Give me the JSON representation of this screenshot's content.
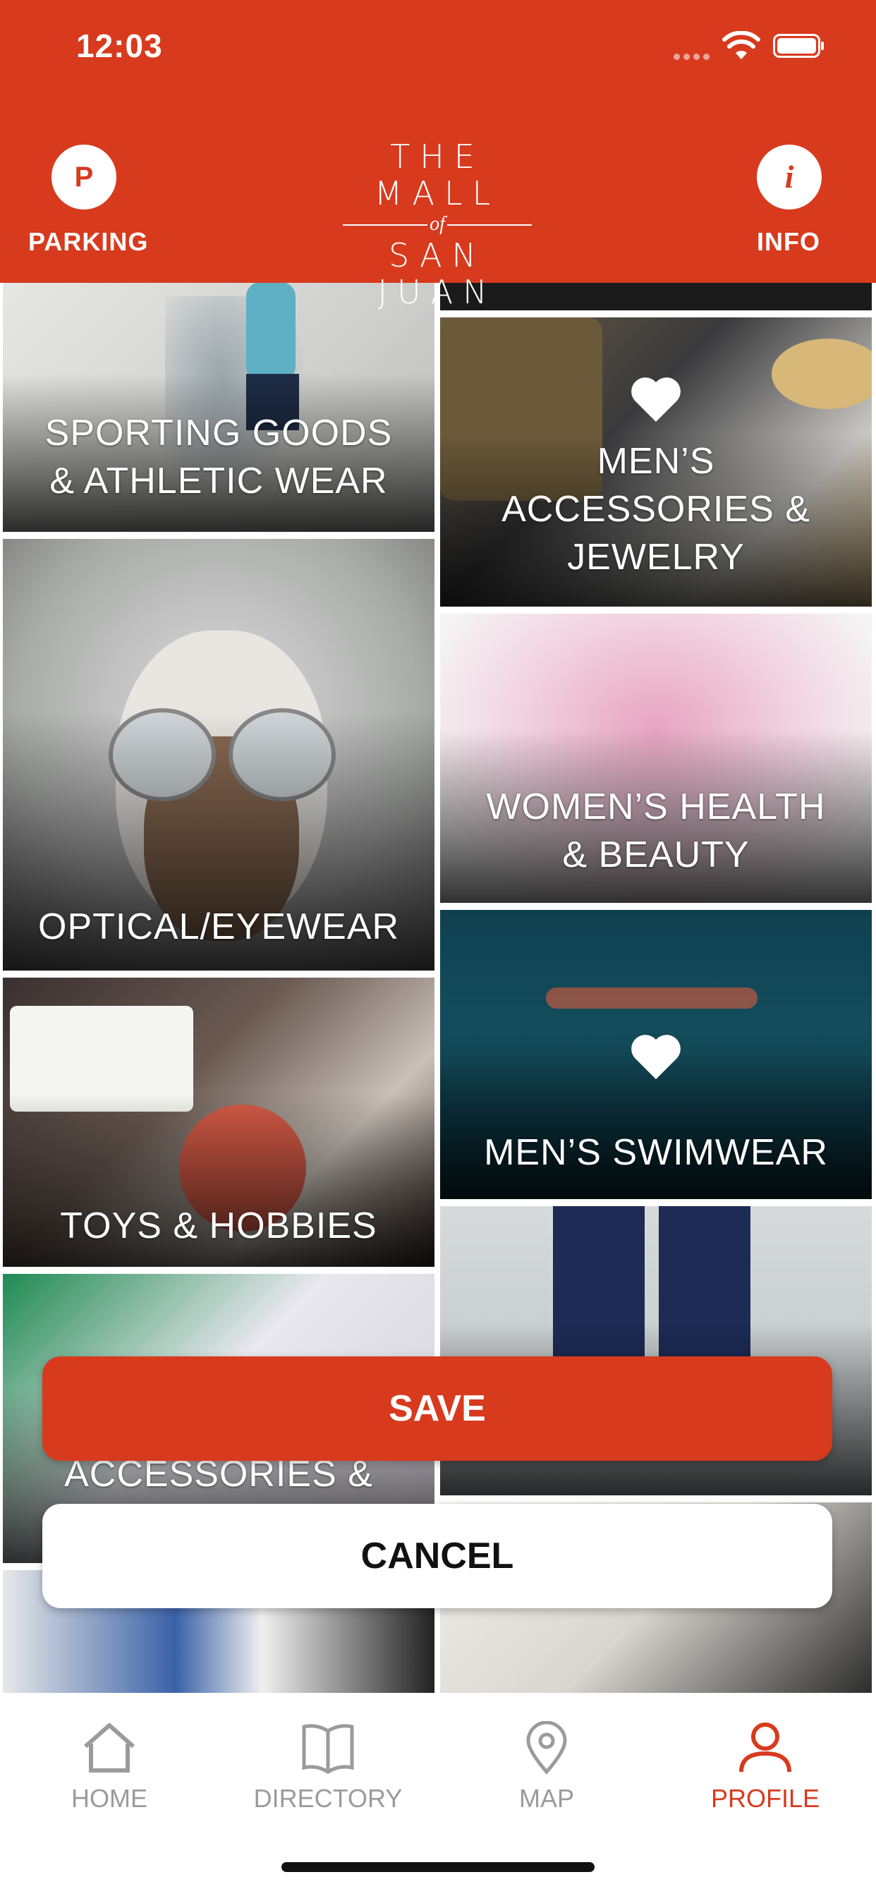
{
  "status_bar": {
    "time": "12:03"
  },
  "header": {
    "parking_icon_letter": "P",
    "parking_label": "PARKING",
    "info_icon_letter": "i",
    "info_label": "INFO",
    "logo": {
      "line1": "THE MALL",
      "line2": "of",
      "line3": "SAN JUAN"
    },
    "brand_color": "#d83a1e"
  },
  "categories": [
    {
      "label": "SPORTING GOODS\n& ATHLETIC WEAR",
      "favorited": false
    },
    {
      "label": "MEN’S\nACCESSORIES &\nJEWELRY",
      "favorited": true
    },
    {
      "label": "OPTICAL/EYEWEAR",
      "favorited": false
    },
    {
      "label": "WOMEN’S HEALTH\n& BEAUTY",
      "favorited": false
    },
    {
      "label": "MEN’S SWIMWEAR",
      "favorited": true
    },
    {
      "label": "TOYS & HOBBIES",
      "favorited": false
    },
    {
      "label": "ACCESSORIES &",
      "favorited": false
    }
  ],
  "actions": {
    "save_label": "SAVE",
    "cancel_label": "CANCEL"
  },
  "tabbar": {
    "home": "HOME",
    "directory": "DIRECTORY",
    "map": "MAP",
    "profile": "PROFILE",
    "active": "profile"
  },
  "icons": [
    "parking-icon",
    "info-icon",
    "heart-icon",
    "home-icon",
    "book-icon",
    "map-pin-icon",
    "user-icon",
    "wifi-icon",
    "battery-icon"
  ]
}
